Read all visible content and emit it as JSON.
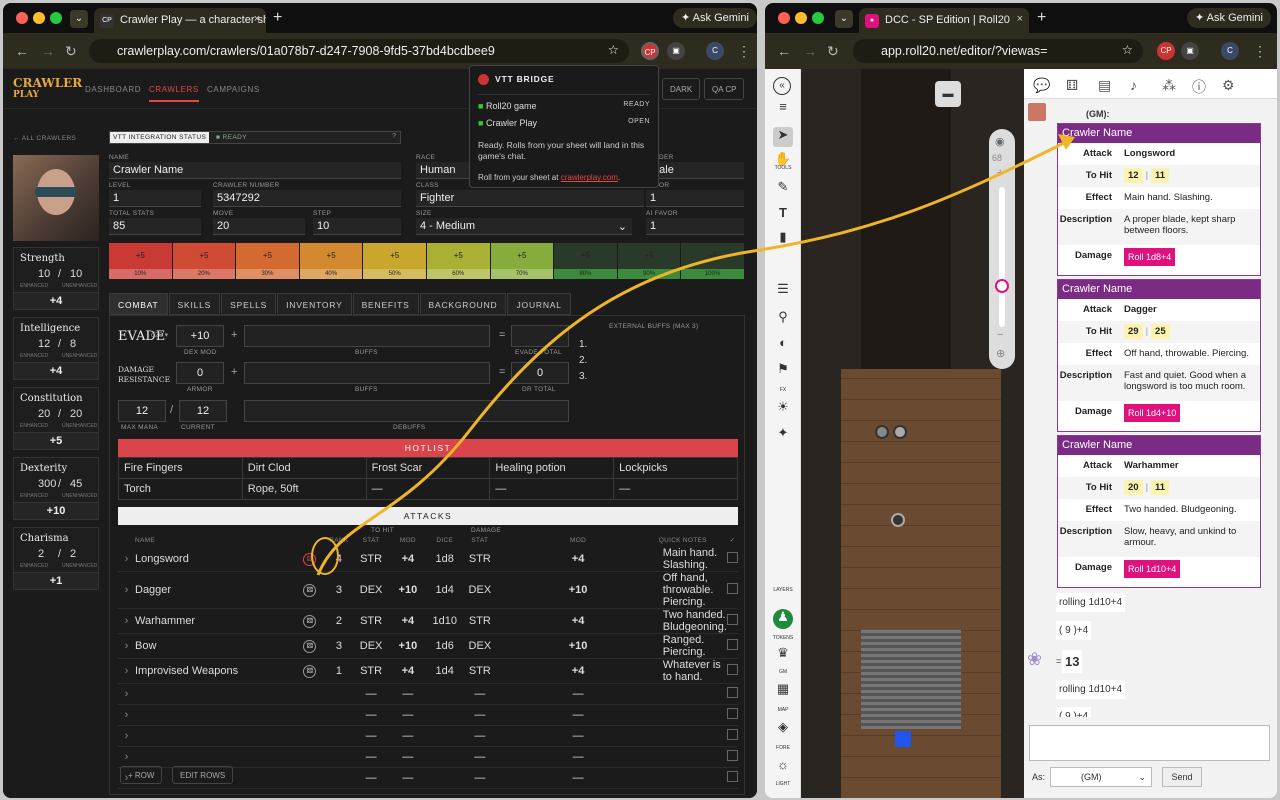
{
  "left": {
    "tab_title": "Crawler Play — a character sh",
    "tab_icon": "CP",
    "ask_gemini": "Ask Gemini",
    "url": "crawlerplay.com/crawlers/01a078b7-d247-7908-9fd5-37bd4bcdbee9",
    "logo": "CRAWLER PLAY",
    "nav": [
      "DASHBOARD",
      "CRAWLERS",
      "CAMPAIGNS"
    ],
    "btn_dark": "DARK",
    "btn_qa": "QA CP",
    "all_crawlers": "← ALL CRAWLERS",
    "vtt_status_label": "VTT INTEGRATION STATUS",
    "vtt_status": "READY",
    "vtt_q": "?",
    "fields": {
      "name_l": "NAME",
      "name": "Crawler Name",
      "race_l": "RACE",
      "race": "Human",
      "gender_l": "DER",
      "gender": "male",
      "level_l": "LEVEL",
      "level": "1",
      "cnum_l": "CRAWLER NUMBER",
      "cnum": "5347292",
      "class_l": "CLASS",
      "class": "Fighter",
      "ext_l": "OR",
      "ext": "1",
      "total_l": "TOTAL STATS",
      "total": "85",
      "move_l": "MOVE",
      "move": "20",
      "step_l": "STEP",
      "step": "10",
      "size_l": "SIZE",
      "size": "4 - Medium",
      "ai_l": "AI FAVOR",
      "ai": "1"
    },
    "stats": [
      {
        "name": "Strength",
        "a": "10",
        "b": "10",
        "mod": "+4"
      },
      {
        "name": "Intelligence",
        "a": "12",
        "b": "8",
        "mod": "+4"
      },
      {
        "name": "Constitution",
        "a": "20",
        "b": "20",
        "mod": "+5"
      },
      {
        "name": "Dexterity",
        "a": "300",
        "b": "45",
        "mod": "+10"
      },
      {
        "name": "Charisma",
        "a": "2",
        "b": "2",
        "mod": "+1"
      }
    ],
    "stat_sub_a": "ENHANCED",
    "stat_sub_b": "UNENHANCED",
    "health_bar": [
      {
        "t": "+5",
        "b": "10%",
        "c": "#c93a34"
      },
      {
        "t": "+5",
        "b": "20%",
        "c": "#cf4b33"
      },
      {
        "t": "+5",
        "b": "30%",
        "c": "#d46a2f"
      },
      {
        "t": "+5",
        "b": "40%",
        "c": "#d38a2e"
      },
      {
        "t": "+5",
        "b": "50%",
        "c": "#c9a62c"
      },
      {
        "t": "+5",
        "b": "60%",
        "c": "#a9b034"
      },
      {
        "t": "+5",
        "b": "70%",
        "c": "#86ad3b"
      },
      {
        "t": "+5",
        "b": "80%",
        "c": "#2a3a2a"
      },
      {
        "t": "+5",
        "b": "90%",
        "c": "#2a3a2a"
      },
      {
        "t": "+5",
        "b": "100%",
        "c": "#2a3a2a"
      }
    ],
    "tabs": [
      "COMBAT",
      "SKILLS",
      "SPELLS",
      "INVENTORY",
      "BENEFITS",
      "BACKGROUND",
      "JOURNAL"
    ],
    "evade": "EVADE",
    "d20": "d20 ▾",
    "evade_val": "+10",
    "dexmod_l": "DEX MOD",
    "buffs_l": "BUFFS",
    "evade_total_l": "EVADE TOTAL",
    "dr": "DAMAGE RESISTANCE",
    "dr_val": "0",
    "armor_l": "ARMOR",
    "dr_total": "0",
    "dr_total_l": "DR TOTAL",
    "mana": "12",
    "mana_cur": "12",
    "maxmana_l": "MAX MANA",
    "current_l": "CURRENT",
    "debuffs_l": "DEBUFFS",
    "ext_buffs_l": "EXTERNAL BUFFS (MAX 3)",
    "ext_list": [
      "1.",
      "2.",
      "3."
    ],
    "hotlist_title": "HOTLIST",
    "hotlist": [
      "Fire Fingers",
      "Dirt Clod",
      "Frost Scar",
      "Healing potion",
      "Lockpicks",
      "Torch",
      "Rope, 50ft",
      "—",
      "—",
      "—"
    ],
    "attacks_title": "ATTACKS",
    "att_head": [
      "NAME",
      "",
      "RANK",
      "STAT",
      "MOD",
      "DICE",
      "STAT",
      "MOD",
      "QUICK NOTES",
      "✓"
    ],
    "att_grp1": "TO HIT",
    "att_grp2": "DAMAGE",
    "attacks": [
      [
        "Longsword",
        "4",
        "STR",
        "+4",
        "1d8",
        "STR",
        "+4",
        "Main hand. Slashing."
      ],
      [
        "Dagger",
        "3",
        "DEX",
        "+10",
        "1d4",
        "DEX",
        "+10",
        "Off hand, throwable. Piercing."
      ],
      [
        "Warhammer",
        "2",
        "STR",
        "+4",
        "1d10",
        "STR",
        "+4",
        "Two handed. Bludgeoning."
      ],
      [
        "Bow",
        "3",
        "DEX",
        "+10",
        "1d6",
        "DEX",
        "+10",
        "Ranged. Piercing."
      ],
      [
        "Improvised Weapons",
        "1",
        "STR",
        "+4",
        "1d4",
        "STR",
        "+4",
        "Whatever is to hand."
      ],
      [
        "",
        "",
        "—",
        "—",
        "",
        "—",
        "—",
        ""
      ],
      [
        "",
        "",
        "—",
        "—",
        "",
        "—",
        "—",
        ""
      ],
      [
        "",
        "",
        "—",
        "—",
        "",
        "—",
        "—",
        ""
      ],
      [
        "",
        "",
        "—",
        "—",
        "",
        "—",
        "—",
        ""
      ],
      [
        "",
        "",
        "—",
        "—",
        "",
        "—",
        "—",
        ""
      ]
    ],
    "add_row": "+ ROW",
    "edit_rows": "EDIT ROWS",
    "popup": {
      "title": "VTT BRIDGE",
      "r1": "Roll20 game",
      "r1s": "READY",
      "r2": "Crawler Play",
      "r2s": "OPEN",
      "msg": "Ready. Rolls from your sheet will land in this game's chat.",
      "foot": "Roll from your sheet at ",
      "link": "crawlerplay.com",
      "foot2": "."
    }
  },
  "right": {
    "tab_title": "DCC - SP Edition | Roll20",
    "ask_gemini": "Ask Gemini",
    "url": "app.roll20.net/editor/?viewas=",
    "tool_labels": [
      "TOOLS",
      "FX",
      "LAYERS",
      "TOKENS",
      "GM",
      "MAP",
      "FORE",
      "LIGHT"
    ],
    "zoom": "68",
    "gm": "(GM):",
    "cards": [
      {
        "head": "Crawler Name",
        "attack": "Longsword",
        "hit": [
          "12",
          "11"
        ],
        "effect": "Main hand. Slashing.",
        "desc": "A proper blade, kept sharp between floors.",
        "damage": "Roll 1d8+4"
      },
      {
        "head": "Crawler Name",
        "attack": "Dagger",
        "hit": [
          "29",
          "25"
        ],
        "effect": "Off hand, throwable. Piercing.",
        "desc": "Fast and quiet. Good when a longsword is too much room.",
        "damage": "Roll 1d4+10"
      },
      {
        "head": "Crawler Name",
        "attack": "Warhammer",
        "hit": [
          "20",
          "11"
        ],
        "effect": "Two handed. Bludgeoning.",
        "desc": "Slow, heavy, and unkind to armour.",
        "damage": "Roll 1d10+4"
      }
    ],
    "k_attack": "Attack",
    "k_hit": "To Hit",
    "k_effect": "Effect",
    "k_desc": "Description",
    "k_damage": "Damage",
    "roll1": "rolling 1d10+4",
    "roll1b": "( 9 )+4",
    "result": "13",
    "eq": "=",
    "roll2": "rolling 1d10+4",
    "roll2b": "( 9 )+4",
    "as_l": "As:",
    "as_val": "(GM)",
    "send": "Send"
  }
}
